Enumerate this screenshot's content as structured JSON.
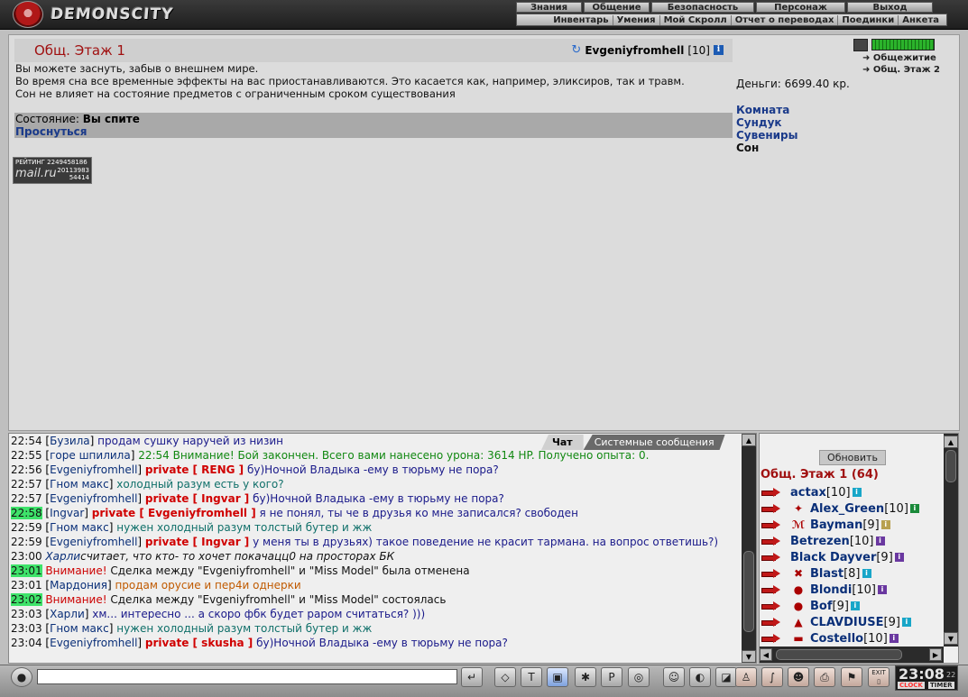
{
  "header": {
    "logo": "DEMONSCITY",
    "nav": [
      "Знания",
      "Общение",
      "Безопасность",
      "Персонаж",
      "Выход"
    ],
    "subnav": [
      "Инвентарь",
      "Умения",
      "Мой Скролл",
      "Отчет о переводах",
      "Поединки",
      "Анкета"
    ]
  },
  "room": {
    "title": "Общ. Этаж 1",
    "user": "Evgeniyfromhell",
    "level": "[10]",
    "info_icon": "i",
    "desc1": "Вы можете заснуть, забыв о внешнем мире.",
    "desc2": "Во время сна все временные эффекты на вас приостанавливаются. Это касается как, например, эликсиров, так и травм.",
    "desc3": "Сон не влияет на состояние предметов с ограниченным сроком существования",
    "state_label": "Состояние:",
    "state_value": "Вы спите",
    "wake": "Проснуться"
  },
  "rating": {
    "label": "РЕЙТИНГ",
    "n1": "2249458186",
    "logo": "mail.ru",
    "n2": "20113983",
    "n3": "54414"
  },
  "side": {
    "loc1": "Общежитие",
    "loc2": "Общ. Этаж 2",
    "money": "Деньги: 6699.40 кр.",
    "menu": [
      "Комната",
      "Сундук",
      "Сувениры",
      "Сон"
    ]
  },
  "chat": {
    "tab_chat": "Чат",
    "tab_sys": "Системные сообщения",
    "m": [
      {
        "t": "22:54",
        "n": "Бузила",
        "x": "продам сушку наручей из низин"
      },
      {
        "t": "22:55",
        "n": "горе шпилила",
        "x": "22:54 Внимание! Бой закончен. Всего вами нанесено урона: 3614 HP. Получено опыта: 0."
      },
      {
        "t": "22:56",
        "n": "Evgeniyfromhell",
        "p": "private [ RENG ]",
        "x": "бу)Ночной Владыка -ему в тюрьму не пора?"
      },
      {
        "t": "22:57",
        "n": "Гном макс",
        "x": "холодный разум есть у кого?"
      },
      {
        "t": "22:57",
        "n": "Evgeniyfromhell",
        "p": "private [ Ingvar ]",
        "x": "бу)Ночной Владыка -ему в тюрьму не пора?"
      },
      {
        "t": "22:58",
        "n": "Ingvar",
        "p": "private [ Evgeniyfromhell ]",
        "x": "я не понял, ты че в друзья ко мне записался? свободен"
      },
      {
        "t": "22:59",
        "n": "Гном макс",
        "x": "нужен холодный разум толстый бутер и жж"
      },
      {
        "t": "22:59",
        "n": "Evgeniyfromhell",
        "p": "private [ Ingvar ]",
        "x": "у меня ты в друзьях) такое поведение не красит тармана. на вопрос ответишь?)"
      },
      {
        "t": "23:00",
        "n": "Харли",
        "x": "считает, что кто- то хочет покачацц0 на просторах БК"
      },
      {
        "t": "23:01",
        "w": "Внимание!",
        "x": "Сделка между \"Evgeniyfromhell\" и \"Miss Model\" была отменена"
      },
      {
        "t": "23:01",
        "n": "Мардония",
        "x": "продам орусие и пер4и однерки"
      },
      {
        "t": "23:02",
        "w": "Внимание!",
        "x": "Сделка между \"Evgeniyfromhell\" и \"Miss Model\" состоялась"
      },
      {
        "t": "23:03",
        "n": "Харли",
        "x": "хм... интересно ... а скоро фбк будет раром считаться? )))"
      },
      {
        "t": "23:03",
        "n": "Гном макс",
        "x": "нужен холодный разум толстый бутер и жж"
      },
      {
        "t": "23:04",
        "n": "Evgeniyfromhell",
        "p": "private [ skusha ]",
        "x": "бу)Ночной Владыка -ему в тюрьму не пора?"
      }
    ]
  },
  "users": {
    "refresh": "Обновить",
    "header": "Общ. Этаж 1 (64)",
    "list": [
      {
        "n": "actax",
        "l": "[10]",
        "i": "i"
      },
      {
        "n": "Alex_Green",
        "l": "[10]",
        "i": "i"
      },
      {
        "n": "Bayman",
        "l": "[9]",
        "i": "i"
      },
      {
        "n": "Betrezen",
        "l": "[10]",
        "i": "i"
      },
      {
        "n": "Black Dayver",
        "l": "[9]",
        "i": "i"
      },
      {
        "n": "Blast",
        "l": "[8]",
        "i": "i"
      },
      {
        "n": "Blondi",
        "l": "[10]",
        "i": "i"
      },
      {
        "n": "Bof",
        "l": "[9]",
        "i": "i"
      },
      {
        "n": "CLAVDIUSE",
        "l": "[9]",
        "i": "i"
      },
      {
        "n": "Costello",
        "l": "[10]",
        "i": "i"
      }
    ]
  },
  "clock": {
    "time": "23:08",
    "sec": "22",
    "clock_label": "CLOCK",
    "timer_label": "TIMER",
    "exit": "EXIT"
  },
  "colors": {
    "accent": "#a01010",
    "link": "#1a3a8a",
    "private": "#d00000",
    "highlight": "#3ee36a"
  }
}
